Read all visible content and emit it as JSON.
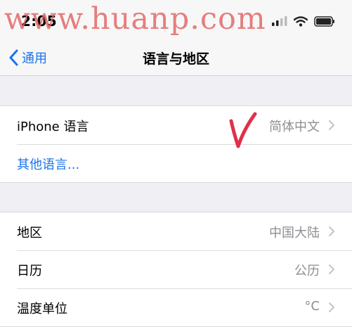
{
  "status_bar": {
    "time": "2:05"
  },
  "watermark": {
    "text": "www.huanp.com"
  },
  "nav": {
    "back_label": "通用",
    "title": "语言与地区"
  },
  "language_section": {
    "iphone_language_label": "iPhone 语言",
    "iphone_language_value": "简体中文",
    "other_languages_label": "其他语言..."
  },
  "region_section": {
    "rows": [
      {
        "label": "地区",
        "value": "中国大陆"
      },
      {
        "label": "日历",
        "value": "公历"
      },
      {
        "label": "温度单位",
        "value": "°C"
      }
    ]
  },
  "colors": {
    "accent": "#1a73e8",
    "annotation": "#e0314a",
    "watermark": "#e26a6a"
  },
  "icons": [
    "signal-icon",
    "wifi-icon",
    "battery-icon",
    "back-chevron-icon",
    "chevron-right-icon",
    "checkmark-annotation"
  ]
}
